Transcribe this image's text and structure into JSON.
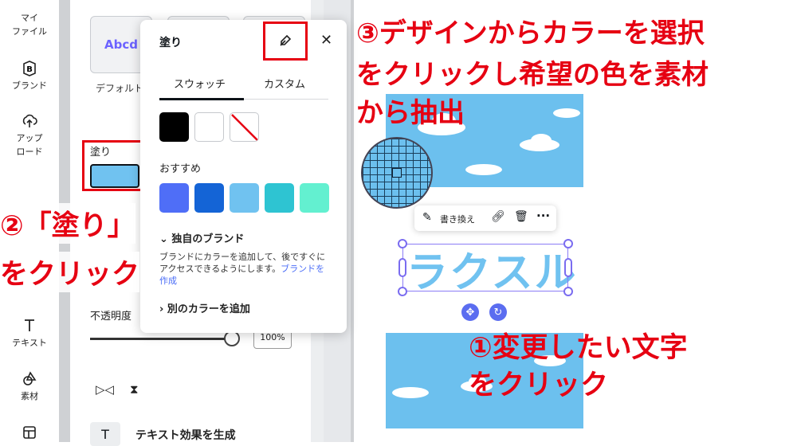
{
  "rail": {
    "items": [
      {
        "label": "マイ\nファイル",
        "icon": "folder-icon"
      },
      {
        "label": "ブランド",
        "icon": "brand-icon"
      },
      {
        "label": "アップ\nロード",
        "icon": "upload-icon"
      },
      {
        "label": "テキスト",
        "icon": "text-icon"
      },
      {
        "label": "素材",
        "icon": "elements-icon"
      }
    ]
  },
  "panel": {
    "thumb_text": "Abcd",
    "thumb_label": "デフォルト",
    "fill_label": "塗り",
    "opacity_label": "不透明度",
    "opacity_value": "100%",
    "opacity_fraction": 1.0,
    "effect_label": "テキスト効果を生成"
  },
  "popup": {
    "title": "塗り",
    "tabs": [
      "スウォッチ",
      "カスタム"
    ],
    "recommended_label": "おすすめ",
    "brand_heading": "独自のブランド",
    "brand_desc": "ブランドにカラーを追加して、後ですぐにアクセスできるようにします。",
    "brand_link": "ブランドを作成",
    "add_color": "別のカラーを追加"
  },
  "colors": {
    "fill": "#70c2f0",
    "recommended": [
      "#4f6ef7",
      "#1464d6",
      "#70c2f0",
      "#2ec4d2",
      "#63f0d0"
    ],
    "annotation": "#e60012",
    "selection": "#7a6cf0"
  },
  "canvas": {
    "selected_text": "ラクスル",
    "toolbar_rewrite": "書き換え"
  },
  "annotations": {
    "step3_line1": "③デザインからカラーを選択",
    "step3_line2": "をクリックし希望の色を素材",
    "step3_line3": "から抽出",
    "step2_line1": "②「塗り」",
    "step2_line2": "をクリック",
    "step1_line1": "①変更したい文字",
    "step1_line2": "をクリック"
  }
}
